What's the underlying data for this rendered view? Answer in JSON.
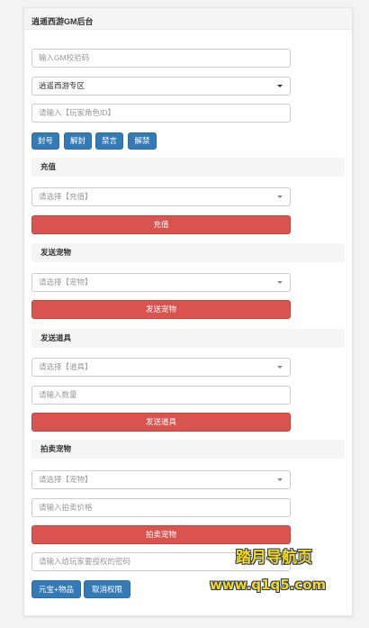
{
  "header": {
    "title": "逍遥西游GM后台"
  },
  "gm_code": {
    "placeholder": "输入GM校验码"
  },
  "zone": {
    "value": "逍遥西游专区"
  },
  "role_id": {
    "placeholder": "请输入【玩家角色ID】"
  },
  "actions": [
    "封号",
    "解封",
    "禁言",
    "解禁"
  ],
  "recharge": {
    "title": "充值",
    "select_placeholder": "请选择【充值】",
    "button": "充值"
  },
  "send_pet": {
    "title": "发送宠物",
    "select_placeholder": "请选择【宠物】",
    "button": "发送宠物"
  },
  "send_item": {
    "title": "发送道具",
    "select_placeholder": "请选择【道具】",
    "quantity_placeholder": "请输入数量",
    "button": "发送道具"
  },
  "auction_pet": {
    "title": "拍卖宠物",
    "select_placeholder": "请选择【宠物】",
    "price_placeholder": "请输入拍卖价格",
    "button": "拍卖宠物"
  },
  "password": {
    "placeholder": "请输入给玩家要授权的密码"
  },
  "footer_buttons": [
    "元宝+物品",
    "取消权限"
  ],
  "watermark": {
    "line1": "踏月导航页",
    "line2": "www.q1q5.com"
  },
  "colors": {
    "primary": "#337ab7",
    "danger": "#d9534f",
    "watermark": "#ffd800"
  }
}
